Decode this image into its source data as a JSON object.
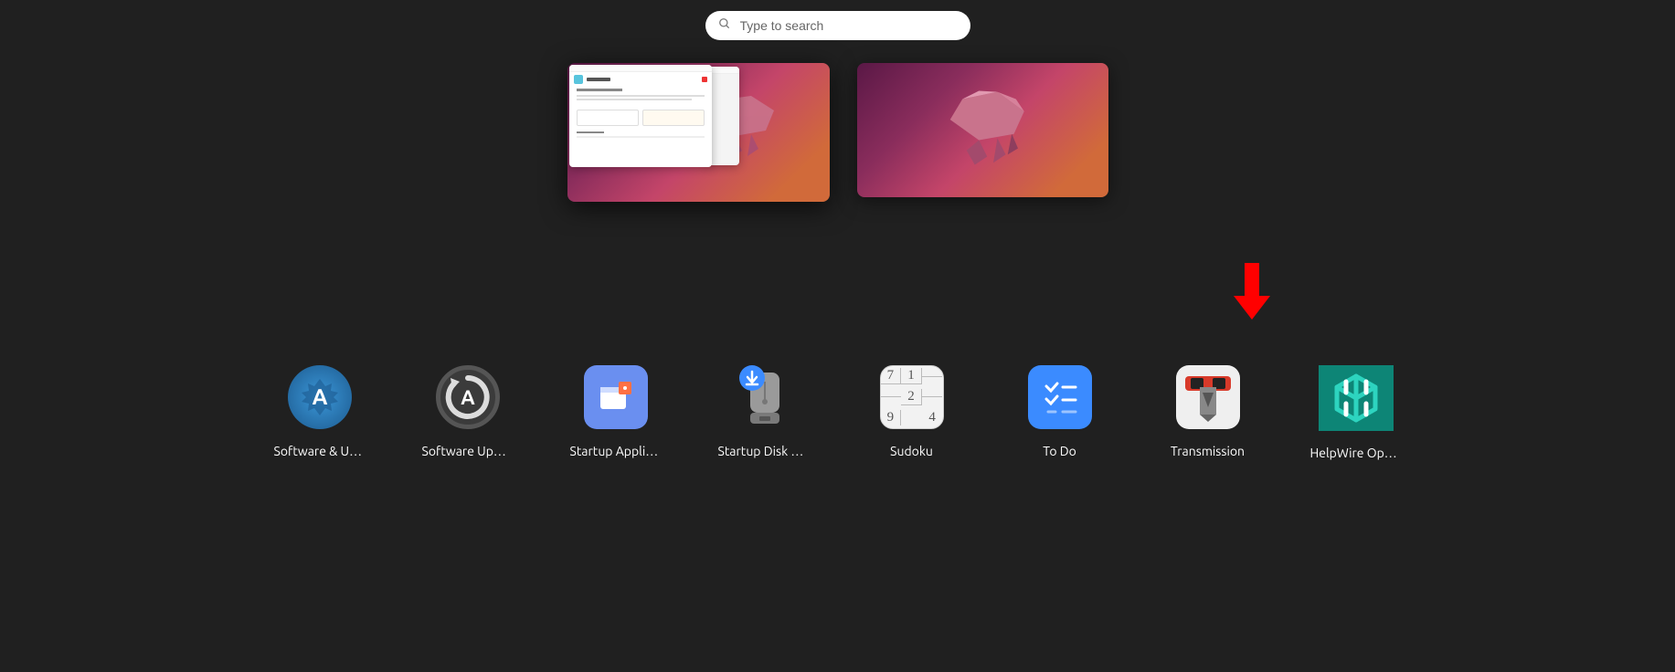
{
  "search": {
    "placeholder": "Type to search",
    "value": ""
  },
  "workspaces": [
    {
      "id": 1,
      "active": true,
      "has_windows": true
    },
    {
      "id": 2,
      "active": false,
      "has_windows": false
    }
  ],
  "apps": [
    {
      "key": "software-updates",
      "label": "Software & Up…"
    },
    {
      "key": "software-updater",
      "label": "Software Upda…"
    },
    {
      "key": "startup-apps",
      "label": "Startup Applic…"
    },
    {
      "key": "startup-disk",
      "label": "Startup Disk Cr…"
    },
    {
      "key": "sudoku",
      "label": "Sudoku"
    },
    {
      "key": "todo",
      "label": "To Do"
    },
    {
      "key": "transmission",
      "label": "Transmission"
    },
    {
      "key": "helpwire",
      "label": "HelpWire Oper…"
    }
  ],
  "sudoku_cells": [
    "7",
    "1",
    "",
    "",
    "2",
    "",
    "9",
    "",
    "4"
  ],
  "annotation": {
    "type": "arrow",
    "color": "#ff0000",
    "target": "helpwire"
  }
}
